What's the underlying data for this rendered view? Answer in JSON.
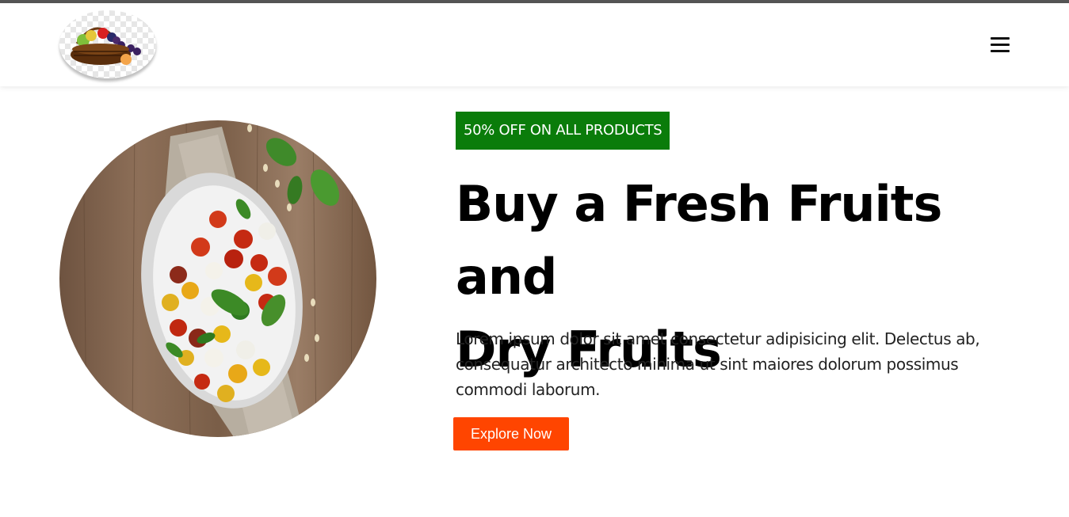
{
  "header": {
    "logo_alt": "fruit-basket-logo",
    "menu_icon": "hamburger-menu-icon"
  },
  "hero": {
    "badge": "50% OFF ON ALL PRODUCTS",
    "title_line1": "Buy a Fresh Fruits and",
    "title_line2": "Dry Fruits",
    "description": "Lorem ipsum dolor sit amet consectetur adipisicing elit. Delectus ab, consequatur architecto minima ut sint maiores dolorum possimus commodi laborum.",
    "cta_label": "Explore Now",
    "image": "salad-bowl-image"
  },
  "colors": {
    "badge_bg": "#0a7c0a",
    "cta_bg": "#ff4500",
    "topbar": "#555555"
  }
}
